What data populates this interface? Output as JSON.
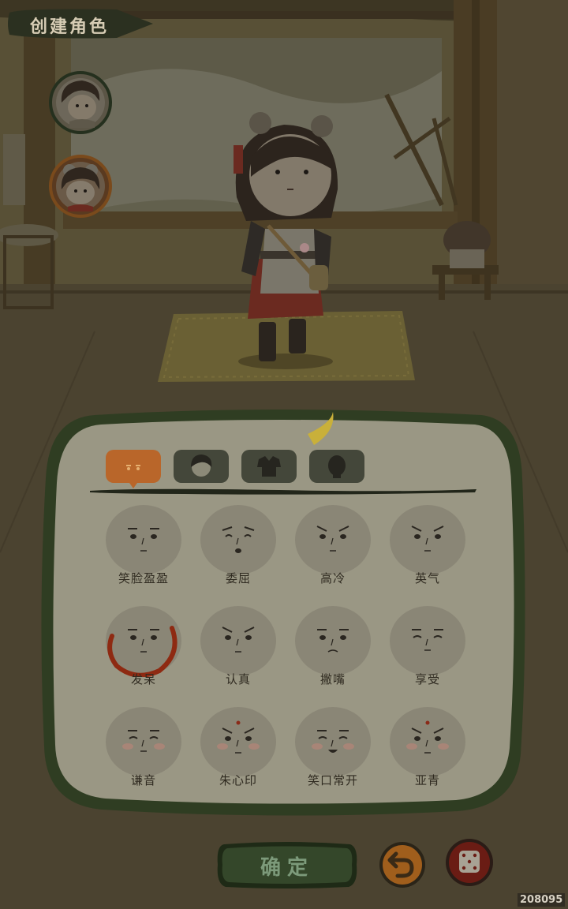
{
  "header": {
    "title": "创建角色"
  },
  "portraits": [
    {
      "name": "male-portrait",
      "icon": "boy-avatar-icon"
    },
    {
      "name": "female-portrait",
      "icon": "girl-avatar-icon",
      "selected": true
    }
  ],
  "tabs": [
    {
      "name": "tab-expression",
      "icon": "face-expression-icon",
      "active": true
    },
    {
      "name": "tab-hair",
      "icon": "hair-icon",
      "active": false
    },
    {
      "name": "tab-clothes",
      "icon": "robe-icon",
      "active": false
    },
    {
      "name": "tab-skin",
      "icon": "head-silhouette-icon",
      "active": false
    }
  ],
  "expressions": [
    {
      "label": "笑脸盈盈"
    },
    {
      "label": "委屈"
    },
    {
      "label": "高冷"
    },
    {
      "label": "英气"
    },
    {
      "label": "发呆",
      "selected": true
    },
    {
      "label": "认真"
    },
    {
      "label": "撇嘴"
    },
    {
      "label": "享受"
    },
    {
      "label": "谦音"
    },
    {
      "label": "朱心印"
    },
    {
      "label": "笑口常开"
    },
    {
      "label": "亚青"
    }
  ],
  "actions": {
    "confirm_label": "确定",
    "undo_icon": "undo-arrow-icon",
    "random_icon": "dice-icon"
  },
  "watermark": "208095",
  "colors": {
    "accent_orange": "#b9662a",
    "panel_fill": "#9a9784",
    "frame_green": "#2f3d22",
    "selection_ring": "#8e2a12"
  }
}
